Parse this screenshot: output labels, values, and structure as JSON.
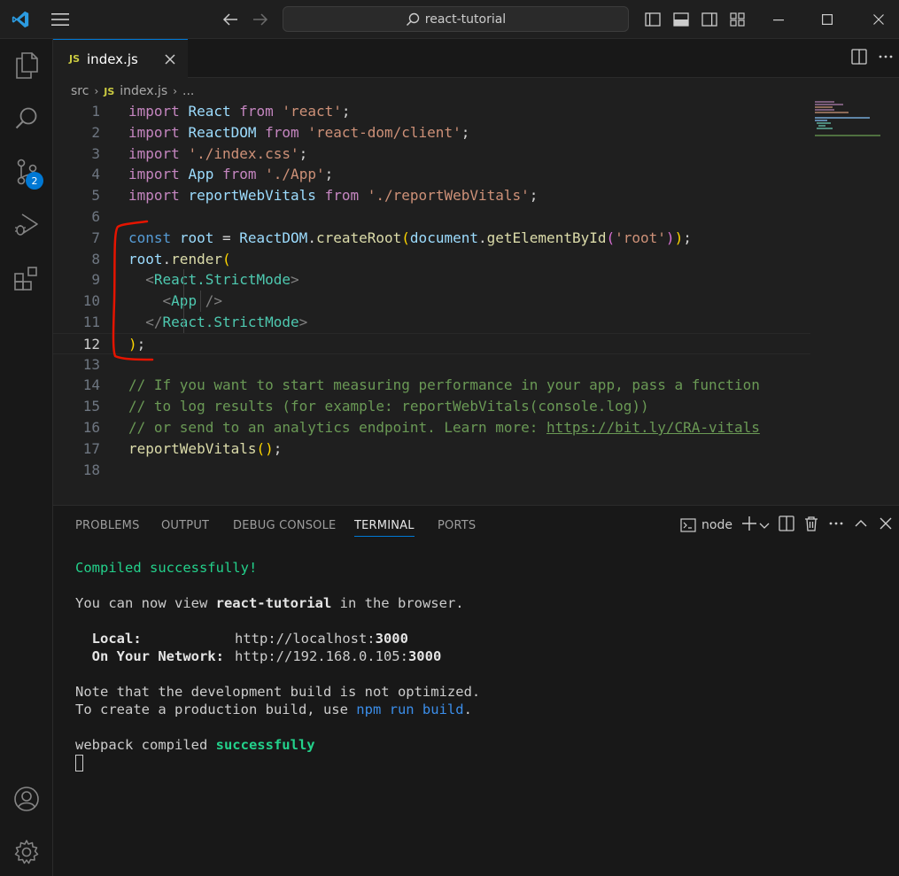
{
  "titlebar": {
    "search_text": "react-tutorial"
  },
  "activitybar": {
    "source_control_badge": "2"
  },
  "tab": {
    "icon_text": "JS",
    "filename": "index.js"
  },
  "breadcrumb": {
    "folder": "src",
    "file_icon_text": "JS",
    "file": "index.js",
    "more": "..."
  },
  "editor": {
    "line_numbers": [
      "1",
      "2",
      "3",
      "4",
      "5",
      "6",
      "7",
      "8",
      "9",
      "10",
      "11",
      "12",
      "13",
      "14",
      "15",
      "16",
      "17",
      "18"
    ],
    "active_line": "12",
    "lines": [
      [
        {
          "t": "import",
          "c": "kw"
        },
        {
          "t": " ",
          "c": ""
        },
        {
          "t": "React",
          "c": "var"
        },
        {
          "t": " ",
          "c": ""
        },
        {
          "t": "from",
          "c": "kw"
        },
        {
          "t": " ",
          "c": ""
        },
        {
          "t": "'react'",
          "c": "str"
        },
        {
          "t": ";",
          "c": "pun"
        }
      ],
      [
        {
          "t": "import",
          "c": "kw"
        },
        {
          "t": " ",
          "c": ""
        },
        {
          "t": "ReactDOM",
          "c": "var"
        },
        {
          "t": " ",
          "c": ""
        },
        {
          "t": "from",
          "c": "kw"
        },
        {
          "t": " ",
          "c": ""
        },
        {
          "t": "'react-dom/client'",
          "c": "str"
        },
        {
          "t": ";",
          "c": "pun"
        }
      ],
      [
        {
          "t": "import",
          "c": "kw"
        },
        {
          "t": " ",
          "c": ""
        },
        {
          "t": "'./index.css'",
          "c": "str"
        },
        {
          "t": ";",
          "c": "pun"
        }
      ],
      [
        {
          "t": "import",
          "c": "kw"
        },
        {
          "t": " ",
          "c": ""
        },
        {
          "t": "App",
          "c": "var"
        },
        {
          "t": " ",
          "c": ""
        },
        {
          "t": "from",
          "c": "kw"
        },
        {
          "t": " ",
          "c": ""
        },
        {
          "t": "'./App'",
          "c": "str"
        },
        {
          "t": ";",
          "c": "pun"
        }
      ],
      [
        {
          "t": "import",
          "c": "kw"
        },
        {
          "t": " ",
          "c": ""
        },
        {
          "t": "reportWebVitals",
          "c": "var"
        },
        {
          "t": " ",
          "c": ""
        },
        {
          "t": "from",
          "c": "kw"
        },
        {
          "t": " ",
          "c": ""
        },
        {
          "t": "'./reportWebVitals'",
          "c": "str"
        },
        {
          "t": ";",
          "c": "pun"
        }
      ],
      [],
      [
        {
          "t": "const",
          "c": "kw2"
        },
        {
          "t": " ",
          "c": ""
        },
        {
          "t": "root",
          "c": "var"
        },
        {
          "t": " = ",
          "c": "pun"
        },
        {
          "t": "ReactDOM",
          "c": "var"
        },
        {
          "t": ".",
          "c": "pun"
        },
        {
          "t": "createRoot",
          "c": "fn"
        },
        {
          "t": "(",
          "c": "br1"
        },
        {
          "t": "document",
          "c": "var"
        },
        {
          "t": ".",
          "c": "pun"
        },
        {
          "t": "getElementById",
          "c": "fn"
        },
        {
          "t": "(",
          "c": "br2"
        },
        {
          "t": "'root'",
          "c": "str"
        },
        {
          "t": ")",
          "c": "br2"
        },
        {
          "t": ")",
          "c": "br1"
        },
        {
          "t": ";",
          "c": "pun"
        }
      ],
      [
        {
          "t": "root",
          "c": "var"
        },
        {
          "t": ".",
          "c": "pun"
        },
        {
          "t": "render",
          "c": "fn"
        },
        {
          "t": "(",
          "c": "br1"
        }
      ],
      [
        {
          "t": "  ",
          "c": ""
        },
        {
          "t": "<",
          "c": "tag"
        },
        {
          "t": "React.StrictMode",
          "c": "cls"
        },
        {
          "t": ">",
          "c": "tag"
        }
      ],
      [
        {
          "t": "    ",
          "c": ""
        },
        {
          "t": "<",
          "c": "tag"
        },
        {
          "t": "App",
          "c": "cls"
        },
        {
          "t": " />",
          "c": "tag"
        }
      ],
      [
        {
          "t": "  ",
          "c": ""
        },
        {
          "t": "</",
          "c": "tag"
        },
        {
          "t": "React.StrictMode",
          "c": "cls"
        },
        {
          "t": ">",
          "c": "tag"
        }
      ],
      [
        {
          "t": ")",
          "c": "br1"
        },
        {
          "t": ";",
          "c": "pun"
        }
      ],
      [],
      [
        {
          "t": "// If you want to start measuring performance in your app, pass a function",
          "c": "cmt"
        }
      ],
      [
        {
          "t": "// to log results (for example: reportWebVitals(console.log))",
          "c": "cmt"
        }
      ],
      [
        {
          "t": "// or send to an analytics endpoint. Learn more: ",
          "c": "cmt"
        },
        {
          "t": "https://bit.ly/CRA-vitals",
          "c": "link"
        }
      ],
      [
        {
          "t": "reportWebVitals",
          "c": "fn"
        },
        {
          "t": "(",
          "c": "br1"
        },
        {
          "t": ")",
          "c": "br1"
        },
        {
          "t": ";",
          "c": "pun"
        }
      ],
      []
    ]
  },
  "panel": {
    "tabs": [
      {
        "label": "PROBLEMS",
        "active": false
      },
      {
        "label": "OUTPUT",
        "active": false
      },
      {
        "label": "DEBUG CONSOLE",
        "active": false
      },
      {
        "label": "TERMINAL",
        "active": true
      },
      {
        "label": "PORTS",
        "active": false
      }
    ],
    "terminal_kind": "node"
  },
  "terminal": {
    "compiled": "Compiled successfully!",
    "view_prefix": "You can now view ",
    "app_name": "react-tutorial",
    "view_suffix": " in the browser.",
    "local_label": "  Local:",
    "local_url_base": "http://localhost:",
    "local_port": "3000",
    "network_label": "  On Your Network:",
    "network_url_base": "http://192.168.0.105:",
    "network_port": "3000",
    "note": "Note that the development build is not optimized.",
    "prod_prefix": "To create a production build, use ",
    "prod_cmd": "npm run build",
    "prod_suffix": ".",
    "webpack_prefix": "webpack compiled ",
    "webpack_status": "successfully"
  },
  "colors": {
    "accent": "#0078d4",
    "annotation": "#e51400",
    "terminal_success": "#23d18b"
  }
}
